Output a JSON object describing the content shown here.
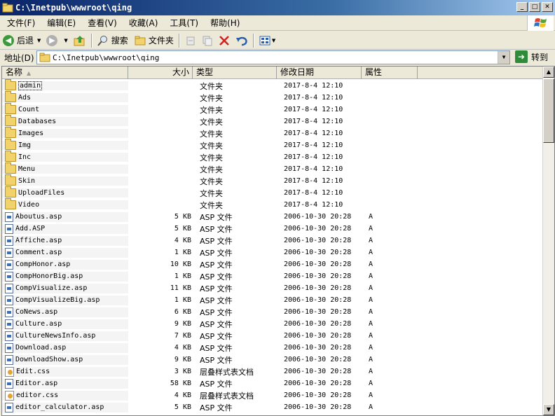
{
  "window": {
    "title": "C:\\Inetpub\\wwwroot\\qing"
  },
  "menu": [
    "文件(F)",
    "编辑(E)",
    "查看(V)",
    "收藏(A)",
    "工具(T)",
    "帮助(H)"
  ],
  "toolbar": {
    "back": "后退",
    "search": "搜索",
    "folders": "文件夹"
  },
  "address": {
    "label": "地址(D)",
    "value": "C:\\Inetpub\\wwwroot\\qing",
    "go": "转到"
  },
  "columns": {
    "name": "名称",
    "size": "大小",
    "type": "类型",
    "date": "修改日期",
    "attr": "属性"
  },
  "colors": {
    "folder": "#f2d36b",
    "title_start": "#0a246a",
    "go": "#2e8b3a"
  },
  "files": [
    {
      "icon": "folder-icon",
      "name": "admin",
      "size": "",
      "type": "文件夹",
      "date": "2017-8-4 12:10",
      "attr": ""
    },
    {
      "icon": "folder-icon",
      "name": "Ads",
      "size": "",
      "type": "文件夹",
      "date": "2017-8-4 12:10",
      "attr": ""
    },
    {
      "icon": "folder-icon",
      "name": "Count",
      "size": "",
      "type": "文件夹",
      "date": "2017-8-4 12:10",
      "attr": ""
    },
    {
      "icon": "folder-icon",
      "name": "Databases",
      "size": "",
      "type": "文件夹",
      "date": "2017-8-4 12:10",
      "attr": ""
    },
    {
      "icon": "folder-icon",
      "name": "Images",
      "size": "",
      "type": "文件夹",
      "date": "2017-8-4 12:10",
      "attr": ""
    },
    {
      "icon": "folder-icon",
      "name": "Img",
      "size": "",
      "type": "文件夹",
      "date": "2017-8-4 12:10",
      "attr": ""
    },
    {
      "icon": "folder-icon",
      "name": "Inc",
      "size": "",
      "type": "文件夹",
      "date": "2017-8-4 12:10",
      "attr": ""
    },
    {
      "icon": "folder-icon",
      "name": "Menu",
      "size": "",
      "type": "文件夹",
      "date": "2017-8-4 12:10",
      "attr": ""
    },
    {
      "icon": "folder-icon",
      "name": "Skin",
      "size": "",
      "type": "文件夹",
      "date": "2017-8-4 12:10",
      "attr": ""
    },
    {
      "icon": "folder-icon",
      "name": "UploadFiles",
      "size": "",
      "type": "文件夹",
      "date": "2017-8-4 12:10",
      "attr": ""
    },
    {
      "icon": "folder-icon",
      "name": "Video",
      "size": "",
      "type": "文件夹",
      "date": "2017-8-4 12:10",
      "attr": ""
    },
    {
      "icon": "asp-file-icon",
      "name": "Aboutus.asp",
      "size": "5 KB",
      "type": "ASP 文件",
      "date": "2006-10-30 20:28",
      "attr": "A"
    },
    {
      "icon": "asp-file-icon",
      "name": "Add.ASP",
      "size": "5 KB",
      "type": "ASP 文件",
      "date": "2006-10-30 20:28",
      "attr": "A"
    },
    {
      "icon": "asp-file-icon",
      "name": "Affiche.asp",
      "size": "4 KB",
      "type": "ASP 文件",
      "date": "2006-10-30 20:28",
      "attr": "A"
    },
    {
      "icon": "asp-file-icon",
      "name": "Comment.asp",
      "size": "1 KB",
      "type": "ASP 文件",
      "date": "2006-10-30 20:28",
      "attr": "A"
    },
    {
      "icon": "asp-file-icon",
      "name": "CompHonor.asp",
      "size": "10 KB",
      "type": "ASP 文件",
      "date": "2006-10-30 20:28",
      "attr": "A"
    },
    {
      "icon": "asp-file-icon",
      "name": "CompHonorBig.asp",
      "size": "1 KB",
      "type": "ASP 文件",
      "date": "2006-10-30 20:28",
      "attr": "A"
    },
    {
      "icon": "asp-file-icon",
      "name": "CompVisualize.asp",
      "size": "11 KB",
      "type": "ASP 文件",
      "date": "2006-10-30 20:28",
      "attr": "A"
    },
    {
      "icon": "asp-file-icon",
      "name": "CompVisualizeBig.asp",
      "size": "1 KB",
      "type": "ASP 文件",
      "date": "2006-10-30 20:28",
      "attr": "A"
    },
    {
      "icon": "asp-file-icon",
      "name": "CoNews.asp",
      "size": "6 KB",
      "type": "ASP 文件",
      "date": "2006-10-30 20:28",
      "attr": "A"
    },
    {
      "icon": "asp-file-icon",
      "name": "Culture.asp",
      "size": "9 KB",
      "type": "ASP 文件",
      "date": "2006-10-30 20:28",
      "attr": "A"
    },
    {
      "icon": "asp-file-icon",
      "name": "CultureNewsInfo.asp",
      "size": "7 KB",
      "type": "ASP 文件",
      "date": "2006-10-30 20:28",
      "attr": "A"
    },
    {
      "icon": "asp-file-icon",
      "name": "Download.asp",
      "size": "4 KB",
      "type": "ASP 文件",
      "date": "2006-10-30 20:28",
      "attr": "A"
    },
    {
      "icon": "asp-file-icon",
      "name": "DownloadShow.asp",
      "size": "9 KB",
      "type": "ASP 文件",
      "date": "2006-10-30 20:28",
      "attr": "A"
    },
    {
      "icon": "css-file-icon",
      "name": "Edit.css",
      "size": "3 KB",
      "type": "层叠样式表文档",
      "date": "2006-10-30 20:28",
      "attr": "A"
    },
    {
      "icon": "asp-file-icon",
      "name": "Editor.asp",
      "size": "58 KB",
      "type": "ASP 文件",
      "date": "2006-10-30 20:28",
      "attr": "A"
    },
    {
      "icon": "css-file-icon",
      "name": "editor.css",
      "size": "4 KB",
      "type": "层叠样式表文档",
      "date": "2006-10-30 20:28",
      "attr": "A"
    },
    {
      "icon": "asp-file-icon",
      "name": "editor_calculator.asp",
      "size": "5 KB",
      "type": "ASP 文件",
      "date": "2006-10-30 20:28",
      "attr": "A"
    }
  ]
}
